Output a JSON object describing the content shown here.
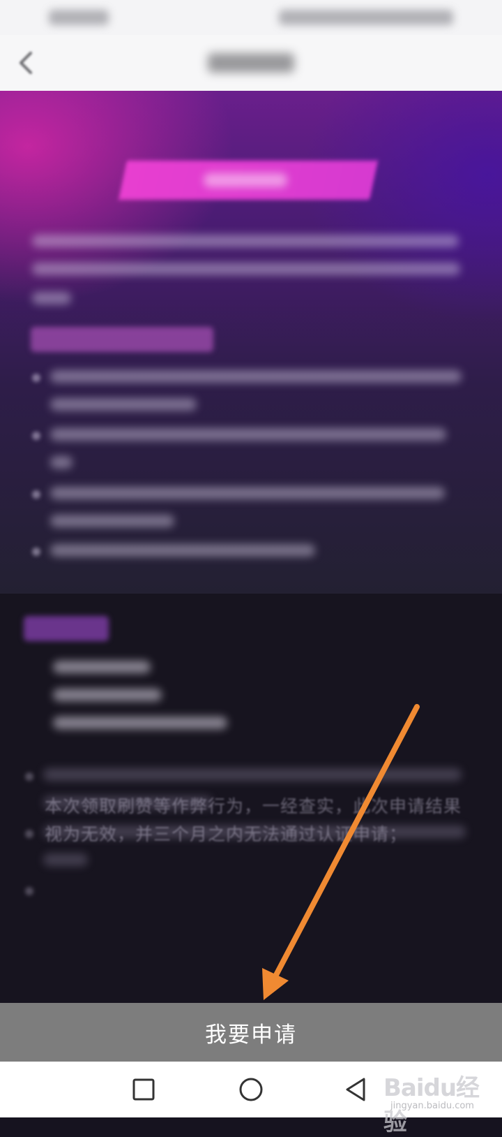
{
  "bottom_action": {
    "label": "我要申请"
  },
  "rules": {
    "visible_text": "本次领取刷赞等作弊行为，一经查实，此次申请结果视为无效，并三个月之内无法通过认证申请；"
  },
  "watermark": {
    "logo": "Baidu经验",
    "url": "jingyan.baidu.com"
  },
  "icons": {
    "back": "back-chevron-icon",
    "arrow": "orange-arrow-pointer",
    "nav_recents": "square-icon",
    "nav_home": "circle-icon",
    "nav_back": "triangle-back-icon"
  },
  "colors": {
    "banner_pink": "#e83fd0",
    "arrow_orange": "#f08a32",
    "button_gray": "#7d7d7d",
    "content_dark": "#17141f"
  }
}
